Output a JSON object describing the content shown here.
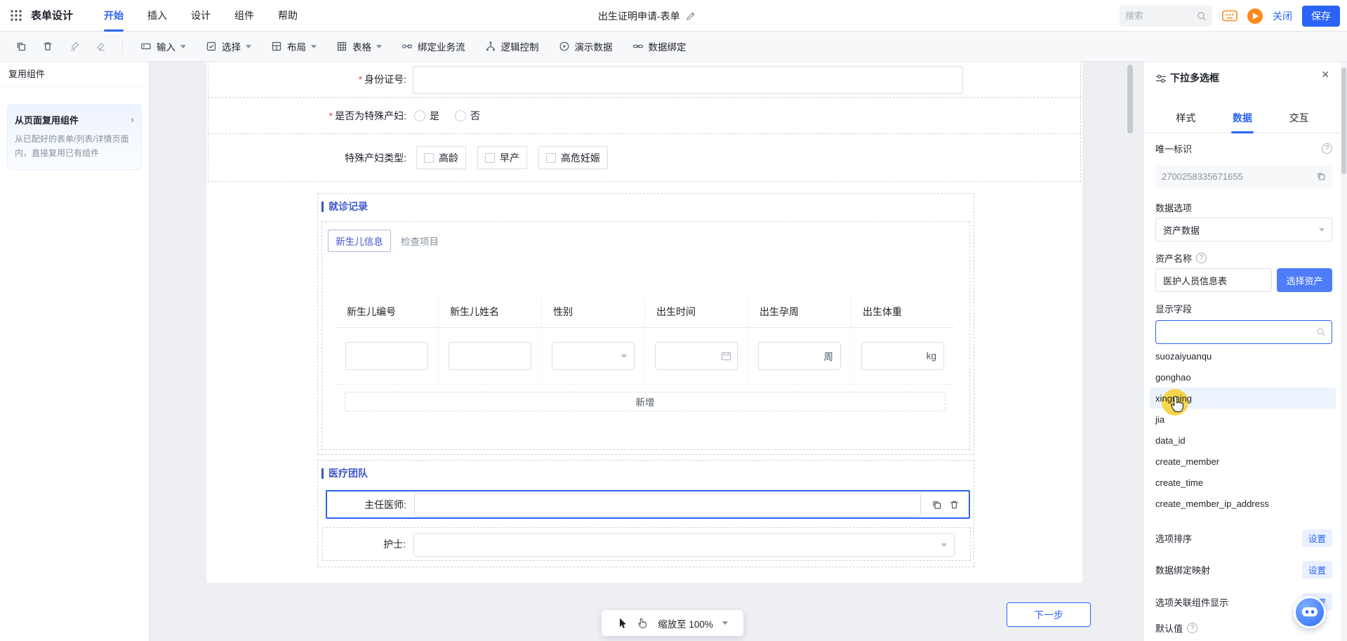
{
  "colors": {
    "primary": "#2A64F6",
    "section_title": "#3D55CC",
    "orange": "#FF8A1E",
    "click_highlight": "#F6D443",
    "select_asset_button": "#4E7CFA"
  },
  "glyphs": {
    "close": "×",
    "help": "?",
    "chevron_right": "›"
  },
  "topbar": {
    "app_title": "表单设计",
    "menu": [
      "开始",
      "插入",
      "设计",
      "组件",
      "帮助"
    ],
    "active_menu": "开始",
    "doc_title": "出生证明申请-表单",
    "search_placeholder": "搜索",
    "close_label": "关闭",
    "save_label": "保存"
  },
  "toolbar": {
    "icon_buttons": [
      "copy-icon",
      "delete-icon",
      "format-brush-icon",
      "eraser-icon"
    ],
    "buttons": [
      {
        "label": "输入",
        "icon": "input-icon",
        "dropdown": true
      },
      {
        "label": "选择",
        "icon": "select-icon",
        "dropdown": true
      },
      {
        "label": "布局",
        "icon": "layout-icon",
        "dropdown": true
      },
      {
        "label": "表格",
        "icon": "table-icon",
        "dropdown": true
      },
      {
        "label": "绑定业务流",
        "icon": "flow-icon",
        "dropdown": false
      },
      {
        "label": "逻辑控制",
        "icon": "logic-icon",
        "dropdown": false
      },
      {
        "label": "演示数据",
        "icon": "demo-icon",
        "dropdown": false
      },
      {
        "label": "数据绑定",
        "icon": "bind-icon",
        "dropdown": false
      }
    ]
  },
  "sidebar": {
    "title": "复用组件",
    "card_title": "从页面复用组件",
    "card_desc": "从已配好的表单/列表/详情页面内，直接复用已有组件"
  },
  "form": {
    "required_mark": "*",
    "id_field_label": "身份证号:",
    "special_field_label": "是否为特殊产妇:",
    "radio_yes": "是",
    "radio_no": "否",
    "type_field_label": "特殊产妇类型:",
    "type_options": [
      "高龄",
      "早产",
      "高危妊娠"
    ],
    "visit_section_title": "就诊记录",
    "visit_tabs": [
      "新生儿信息",
      "检查项目"
    ],
    "active_visit_tab": "新生儿信息",
    "table_columns": [
      "新生儿编号",
      "新生儿姓名",
      "性别",
      "出生时间",
      "出生孕周",
      "出生体重"
    ],
    "week_suffix": "周",
    "kg_suffix": "kg",
    "add_row_label": "新增",
    "team_section_title": "医疗团队",
    "doctor_label": "主任医师:",
    "nurse_label": "护士:"
  },
  "footer": {
    "zoom_label": "缩放至 100%",
    "next_button_label": "下一步"
  },
  "panel": {
    "title": "下拉多选框",
    "tabs": [
      "样式",
      "数据",
      "交互"
    ],
    "active_tab": "数据",
    "unique_id_label": "唯一标识",
    "unique_id_value": "2700258335671655",
    "data_options_label": "数据选项",
    "data_options_value": "资产数据",
    "asset_name_label": "资产名称",
    "asset_name_value": "医护人员信息表",
    "select_asset_button": "选择资产",
    "display_field_label": "显示字段",
    "display_field_search_value": "",
    "field_options": [
      "suozaiyuanqu",
      "gonghao",
      "xingming",
      "jia",
      "data_id",
      "create_member",
      "create_time",
      "create_member_ip_address"
    ],
    "highlighted_option": "xingming",
    "option_sort_label": "选项排序",
    "data_binding_map_label": "数据绑定映射",
    "option_linked_label": "选项关联组件显示",
    "default_value_label": "默认值",
    "settings_button": "设置"
  }
}
